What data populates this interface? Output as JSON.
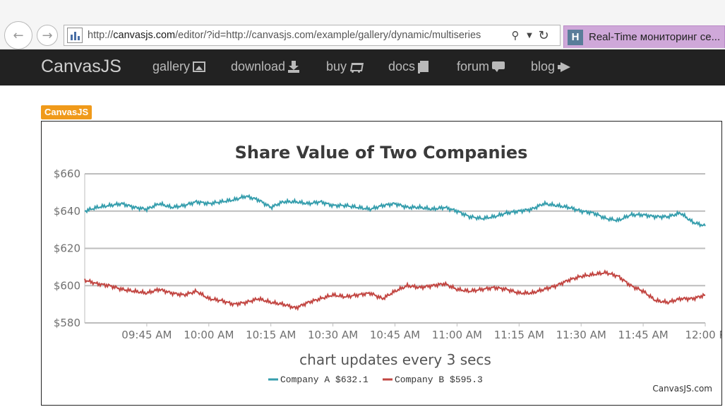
{
  "browser": {
    "url_prefix": "http://",
    "url_domain": "canvasjs.com",
    "url_rest": "/editor/?id=http://canvasjs.com/example/gallery/dynamic/multiseries",
    "tab_title": "Real-Time мониторинг се...",
    "tab_favicon_letter": "H"
  },
  "site_nav": {
    "brand": "CanvasJS",
    "items": [
      {
        "label": "gallery",
        "icon": "image-icon"
      },
      {
        "label": "download",
        "icon": "download-icon"
      },
      {
        "label": "buy",
        "icon": "cart-icon"
      },
      {
        "label": "docs",
        "icon": "book-icon"
      },
      {
        "label": "forum",
        "icon": "chat-icon"
      },
      {
        "label": "blog",
        "icon": "megaphone-icon"
      }
    ]
  },
  "badge": "CanvasJS",
  "chart_data": {
    "type": "line",
    "title": "Share Value of Two Companies",
    "subtitle": "chart updates every 3 secs",
    "credit": "CanvasJS.com",
    "ylim": [
      580,
      660
    ],
    "yticks": [
      580,
      600,
      620,
      640,
      660
    ],
    "ytick_labels": [
      "$580",
      "$600",
      "$620",
      "$640",
      "$660"
    ],
    "xlim_minutes": [
      570,
      720
    ],
    "xticks_minutes": [
      585,
      600,
      615,
      630,
      645,
      660,
      675,
      690,
      705,
      720
    ],
    "xtick_labels": [
      "09:45 AM",
      "10:00 AM",
      "10:15 AM",
      "10:30 AM",
      "10:45 AM",
      "11:00 AM",
      "11:15 AM",
      "11:30 AM",
      "11:45 AM",
      "12:00 P"
    ],
    "grid": true,
    "legend_position": "bottom",
    "series": [
      {
        "name": "Company A",
        "legend_value": "$632.1",
        "color": "#369ead",
        "points": [
          [
            570,
            640
          ],
          [
            573,
            642
          ],
          [
            576,
            643
          ],
          [
            579,
            644
          ],
          [
            582,
            642
          ],
          [
            585,
            641
          ],
          [
            588,
            644
          ],
          [
            591,
            642
          ],
          [
            594,
            643
          ],
          [
            597,
            645
          ],
          [
            600,
            644
          ],
          [
            603,
            645
          ],
          [
            606,
            646
          ],
          [
            609,
            648
          ],
          [
            612,
            646
          ],
          [
            615,
            642
          ],
          [
            618,
            645
          ],
          [
            621,
            645
          ],
          [
            624,
            644
          ],
          [
            627,
            645
          ],
          [
            630,
            643
          ],
          [
            633,
            643
          ],
          [
            636,
            642
          ],
          [
            639,
            641
          ],
          [
            642,
            643
          ],
          [
            645,
            644
          ],
          [
            648,
            642
          ],
          [
            651,
            642
          ],
          [
            654,
            641
          ],
          [
            657,
            642
          ],
          [
            660,
            640
          ],
          [
            663,
            637
          ],
          [
            666,
            636
          ],
          [
            669,
            637
          ],
          [
            672,
            639
          ],
          [
            675,
            640
          ],
          [
            678,
            641
          ],
          [
            681,
            644
          ],
          [
            684,
            643
          ],
          [
            687,
            642
          ],
          [
            690,
            640
          ],
          [
            693,
            639
          ],
          [
            696,
            636
          ],
          [
            699,
            635
          ],
          [
            702,
            638
          ],
          [
            705,
            638
          ],
          [
            708,
            637
          ],
          [
            711,
            637
          ],
          [
            714,
            639
          ],
          [
            717,
            634
          ],
          [
            720,
            632
          ]
        ]
      },
      {
        "name": "Company B",
        "legend_value": "$595.3",
        "color": "#c24642",
        "points": [
          [
            570,
            603
          ],
          [
            573,
            601
          ],
          [
            576,
            600
          ],
          [
            579,
            598
          ],
          [
            582,
            597
          ],
          [
            585,
            596
          ],
          [
            588,
            598
          ],
          [
            591,
            596
          ],
          [
            594,
            595
          ],
          [
            597,
            597
          ],
          [
            600,
            593
          ],
          [
            603,
            592
          ],
          [
            606,
            590
          ],
          [
            609,
            591
          ],
          [
            612,
            593
          ],
          [
            615,
            591
          ],
          [
            618,
            590
          ],
          [
            621,
            588
          ],
          [
            624,
            591
          ],
          [
            627,
            593
          ],
          [
            630,
            595
          ],
          [
            633,
            594
          ],
          [
            636,
            595
          ],
          [
            639,
            596
          ],
          [
            642,
            593
          ],
          [
            645,
            597
          ],
          [
            648,
            600
          ],
          [
            651,
            599
          ],
          [
            654,
            600
          ],
          [
            657,
            601
          ],
          [
            660,
            598
          ],
          [
            663,
            597
          ],
          [
            666,
            598
          ],
          [
            669,
            599
          ],
          [
            672,
            598
          ],
          [
            675,
            596
          ],
          [
            678,
            596
          ],
          [
            681,
            598
          ],
          [
            684,
            600
          ],
          [
            687,
            603
          ],
          [
            690,
            605
          ],
          [
            693,
            606
          ],
          [
            696,
            607
          ],
          [
            699,
            605
          ],
          [
            702,
            600
          ],
          [
            705,
            597
          ],
          [
            708,
            592
          ],
          [
            711,
            591
          ],
          [
            714,
            593
          ],
          [
            717,
            593
          ],
          [
            720,
            595
          ]
        ]
      }
    ]
  }
}
